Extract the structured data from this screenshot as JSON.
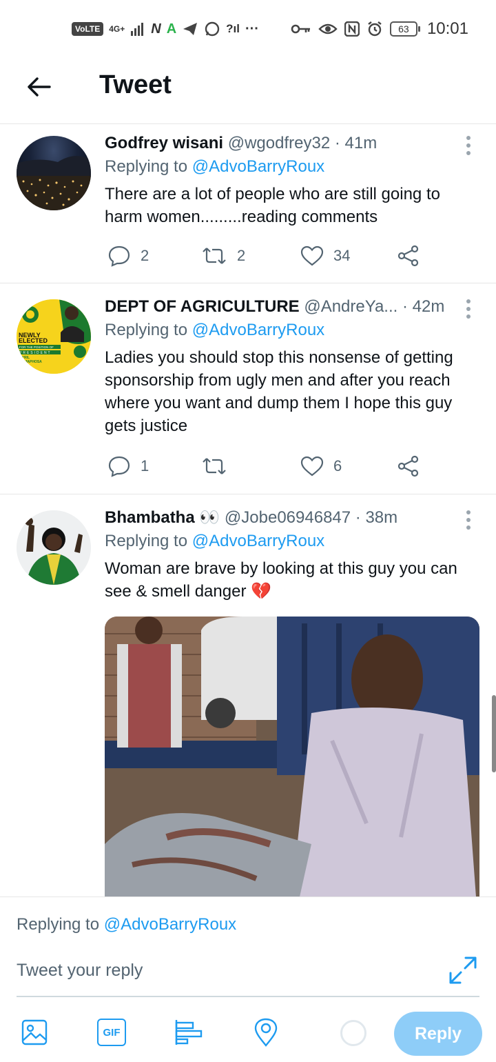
{
  "status_bar": {
    "left_indicators": [
      "VoLTE",
      "4G+",
      "N",
      "A",
      "◂",
      "✆",
      "?ıl",
      "···"
    ],
    "battery": "63",
    "time": "10:01"
  },
  "header": {
    "title": "Tweet",
    "back_icon": "arrow-left-icon"
  },
  "tweets": [
    {
      "name": "Godfrey wisani",
      "handle": "@wgodfrey32",
      "time": "· 41m",
      "replying_prefix": "Replying to ",
      "replying_to": "@AdvoBarryRoux",
      "text": "There are a lot of people who are still going to harm women.........reading comments",
      "replies": "2",
      "retweets": "2",
      "likes": "34"
    },
    {
      "name": "DEPT OF AGRICULTURE",
      "handle": "@AndreYa...",
      "time": "· 42m",
      "replying_prefix": "Replying to ",
      "replying_to": "@AdvoBarryRoux",
      "text": "Ladies you should stop this nonsense of getting sponsorship from ugly men and after you reach where you want and dump them I hope this guy gets justice",
      "replies": "1",
      "retweets": "",
      "likes": "6",
      "avatar_text": [
        "NEWLY",
        "ELECTED",
        "FOR THE POSITION OF",
        "PRESIDENT",
        "CYRIL",
        "RAMAPHOSA"
      ]
    },
    {
      "name": "Bhambatha",
      "name_emoji": "👀",
      "handle": "@Jobe06946847",
      "time": "· 38m",
      "replying_prefix": "Replying to ",
      "replying_to": "@AdvoBarryRoux",
      "text": "Woman are brave by looking at this guy you can see & smell danger",
      "text_emoji": "💔"
    }
  ],
  "composer": {
    "replying_prefix": "Replying to ",
    "replying_to": "@AdvoBarryRoux",
    "placeholder": "Tweet your reply",
    "gif_label": "GIF",
    "reply_button": "Reply"
  },
  "colors": {
    "accent": "#1d9bf0",
    "reply_button_disabled": "#8ecdf8",
    "muted_text": "#536471"
  }
}
